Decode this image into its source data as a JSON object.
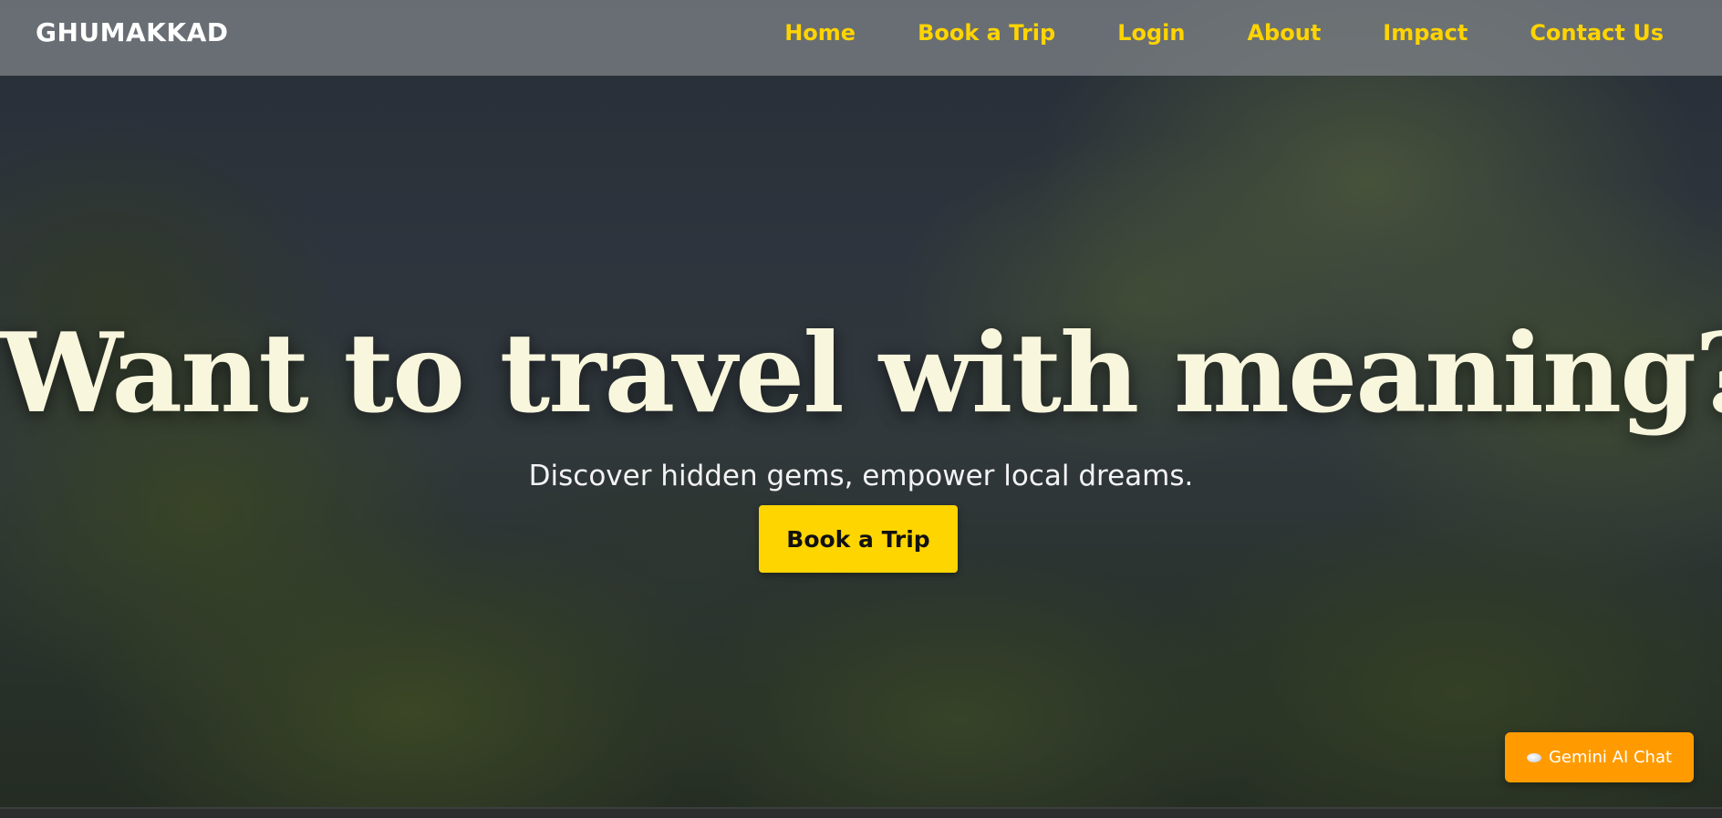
{
  "navbar": {
    "brand": "GHUMAKKAD",
    "links": [
      {
        "label": "Home"
      },
      {
        "label": "Book a Trip"
      },
      {
        "label": "Login"
      },
      {
        "label": "About"
      },
      {
        "label": "Impact"
      },
      {
        "label": "Contact Us"
      }
    ]
  },
  "hero": {
    "title": "Want to travel with meaning?",
    "subtitle": "Discover hidden gems, empower local dreams.",
    "cta_label": "Book a Trip"
  },
  "chat": {
    "label": "Gemini AI Chat",
    "icon": "cloud-icon"
  },
  "colors": {
    "accent": "#ffd500",
    "chat": "#ff9b00",
    "title": "#f8f6dc"
  }
}
